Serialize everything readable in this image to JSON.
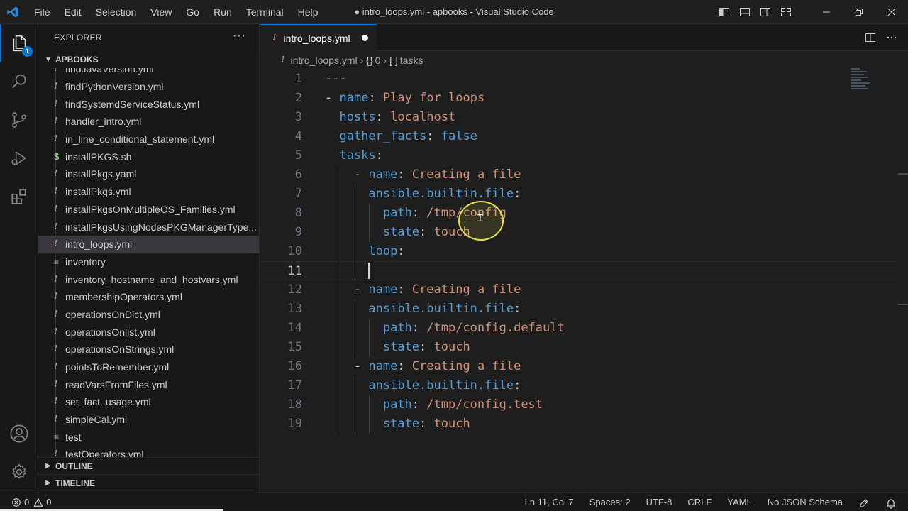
{
  "colors": {
    "accent": "#0078d4",
    "keyword": "#569cd6",
    "string": "#ce9178",
    "yaml_icon": "#c586c0",
    "shell_icon": "#89d185",
    "click_ring": "#e8e04a"
  },
  "titlebar": {
    "app_icon": "vscode-logo-icon",
    "menu": [
      "File",
      "Edit",
      "Selection",
      "View",
      "Go",
      "Run",
      "Terminal",
      "Help"
    ],
    "title": "● intro_loops.yml - apbooks - Visual Studio Code",
    "controls": [
      "toggle-primary-sidebar-icon",
      "toggle-panel-icon",
      "toggle-secondary-sidebar-icon",
      "customize-layout-icon",
      "minimize-icon",
      "restore-icon",
      "close-icon"
    ]
  },
  "activitybar": {
    "items": [
      {
        "icon": "explorer-icon",
        "badge": "1"
      },
      {
        "icon": "search-icon"
      },
      {
        "icon": "source-control-icon"
      },
      {
        "icon": "run-debug-icon"
      },
      {
        "icon": "extensions-icon"
      }
    ],
    "bottom": [
      {
        "icon": "account-icon"
      },
      {
        "icon": "manage-gear-icon"
      }
    ]
  },
  "sidebar": {
    "header": "EXPLORER",
    "more": "···",
    "folder": "APBOOKS",
    "files": [
      {
        "name": "findJavaVersion.yml",
        "type": "yml"
      },
      {
        "name": "findPythonVersion.yml",
        "type": "yml"
      },
      {
        "name": "findSystemdServiceStatus.yml",
        "type": "yml"
      },
      {
        "name": "handler_intro.yml",
        "type": "yml"
      },
      {
        "name": "in_line_conditional_statement.yml",
        "type": "yml"
      },
      {
        "name": "installPKGS.sh",
        "type": "sh"
      },
      {
        "name": "installPkgs.yaml",
        "type": "yml"
      },
      {
        "name": "installPkgs.yml",
        "type": "yml"
      },
      {
        "name": "installPkgsOnMultipleOS_Families.yml",
        "type": "yml"
      },
      {
        "name": "installPkgsUsingNodesPKGManagerType...",
        "type": "yml"
      },
      {
        "name": "intro_loops.yml",
        "type": "yml",
        "selected": true
      },
      {
        "name": "inventory",
        "type": "txt"
      },
      {
        "name": "inventory_hostname_and_hostvars.yml",
        "type": "yml"
      },
      {
        "name": "membershipOperators.yml",
        "type": "yml"
      },
      {
        "name": "operationsOnDict.yml",
        "type": "yml"
      },
      {
        "name": "operationsOnlist.yml",
        "type": "yml"
      },
      {
        "name": "operationsOnStrings.yml",
        "type": "yml"
      },
      {
        "name": "pointsToRemember.yml",
        "type": "yml"
      },
      {
        "name": "readVarsFromFiles.yml",
        "type": "yml"
      },
      {
        "name": "set_fact_usage.yml",
        "type": "yml"
      },
      {
        "name": "simpleCal.yml",
        "type": "yml"
      },
      {
        "name": "test",
        "type": "txt"
      },
      {
        "name": "testOperators.yml",
        "type": "yml"
      }
    ],
    "outline": "OUTLINE",
    "timeline": "TIMELINE"
  },
  "editor": {
    "tab_label": "intro_loops.yml",
    "breadcrumb": {
      "file": "intro_loops.yml",
      "level1_symbol": "{}",
      "level1": "0",
      "level2_symbol": "[ ]",
      "level2": "tasks"
    },
    "actions": [
      "split-editor-icon",
      "more-actions-icon"
    ],
    "current_line": 11,
    "lines": [
      {
        "n": "1",
        "indent": 0,
        "tokens": [
          {
            "t": "---",
            "c": "p"
          }
        ]
      },
      {
        "n": "2",
        "indent": 0,
        "tokens": [
          {
            "t": "- ",
            "c": "p"
          },
          {
            "t": "name",
            "c": "k"
          },
          {
            "t": ": ",
            "c": "p"
          },
          {
            "t": "Play for loops",
            "c": "s"
          }
        ]
      },
      {
        "n": "3",
        "indent": 1,
        "tokens": [
          {
            "t": "hosts",
            "c": "k"
          },
          {
            "t": ": ",
            "c": "p"
          },
          {
            "t": "localhost",
            "c": "s"
          }
        ]
      },
      {
        "n": "4",
        "indent": 1,
        "tokens": [
          {
            "t": "gather_facts",
            "c": "k"
          },
          {
            "t": ": ",
            "c": "p"
          },
          {
            "t": "false",
            "c": "b"
          }
        ]
      },
      {
        "n": "5",
        "indent": 1,
        "tokens": [
          {
            "t": "tasks",
            "c": "k"
          },
          {
            "t": ":",
            "c": "p"
          }
        ]
      },
      {
        "n": "6",
        "indent": 2,
        "tokens": [
          {
            "t": "- ",
            "c": "p"
          },
          {
            "t": "name",
            "c": "k"
          },
          {
            "t": ": ",
            "c": "p"
          },
          {
            "t": "Creating a file",
            "c": "s"
          }
        ]
      },
      {
        "n": "7",
        "indent": 3,
        "tokens": [
          {
            "t": "ansible.builtin.file",
            "c": "k"
          },
          {
            "t": ":",
            "c": "p"
          }
        ]
      },
      {
        "n": "8",
        "indent": 4,
        "tokens": [
          {
            "t": "path",
            "c": "k"
          },
          {
            "t": ": ",
            "c": "p"
          },
          {
            "t": "/tmp/config",
            "c": "s"
          }
        ]
      },
      {
        "n": "9",
        "indent": 4,
        "tokens": [
          {
            "t": "state",
            "c": "k"
          },
          {
            "t": ": ",
            "c": "p"
          },
          {
            "t": "touch",
            "c": "s"
          }
        ]
      },
      {
        "n": "10",
        "indent": 3,
        "tokens": [
          {
            "t": "loop",
            "c": "k"
          },
          {
            "t": ":",
            "c": "p"
          }
        ]
      },
      {
        "n": "11",
        "indent": 3,
        "tokens": []
      },
      {
        "n": "12",
        "indent": 2,
        "tokens": [
          {
            "t": "- ",
            "c": "p"
          },
          {
            "t": "name",
            "c": "k"
          },
          {
            "t": ": ",
            "c": "p"
          },
          {
            "t": "Creating a file",
            "c": "s"
          }
        ]
      },
      {
        "n": "13",
        "indent": 3,
        "tokens": [
          {
            "t": "ansible.builtin.file",
            "c": "k"
          },
          {
            "t": ":",
            "c": "p"
          }
        ]
      },
      {
        "n": "14",
        "indent": 4,
        "tokens": [
          {
            "t": "path",
            "c": "k"
          },
          {
            "t": ": ",
            "c": "p"
          },
          {
            "t": "/tmp/config.default",
            "c": "s"
          }
        ]
      },
      {
        "n": "15",
        "indent": 4,
        "tokens": [
          {
            "t": "state",
            "c": "k"
          },
          {
            "t": ": ",
            "c": "p"
          },
          {
            "t": "touch",
            "c": "s"
          }
        ]
      },
      {
        "n": "16",
        "indent": 2,
        "tokens": [
          {
            "t": "- ",
            "c": "p"
          },
          {
            "t": "name",
            "c": "k"
          },
          {
            "t": ": ",
            "c": "p"
          },
          {
            "t": "Creating a file",
            "c": "s"
          }
        ]
      },
      {
        "n": "17",
        "indent": 3,
        "tokens": [
          {
            "t": "ansible.builtin.file",
            "c": "k"
          },
          {
            "t": ":",
            "c": "p"
          }
        ]
      },
      {
        "n": "18",
        "indent": 4,
        "tokens": [
          {
            "t": "path",
            "c": "k"
          },
          {
            "t": ": ",
            "c": "p"
          },
          {
            "t": "/tmp/config.test",
            "c": "s"
          }
        ]
      },
      {
        "n": "19",
        "indent": 4,
        "tokens": [
          {
            "t": "state",
            "c": "k"
          },
          {
            "t": ": ",
            "c": "p"
          },
          {
            "t": "touch",
            "c": "s"
          }
        ]
      }
    ]
  },
  "statusbar": {
    "errors": "0",
    "warnings": "0",
    "position": "Ln 11, Col 7",
    "spaces": "Spaces: 2",
    "encoding": "UTF-8",
    "eol": "CRLF",
    "language": "YAML",
    "schema": "No JSON Schema",
    "icons": [
      "error-icon",
      "warning-icon",
      "copilot-icon",
      "notifications-bell-icon"
    ]
  }
}
